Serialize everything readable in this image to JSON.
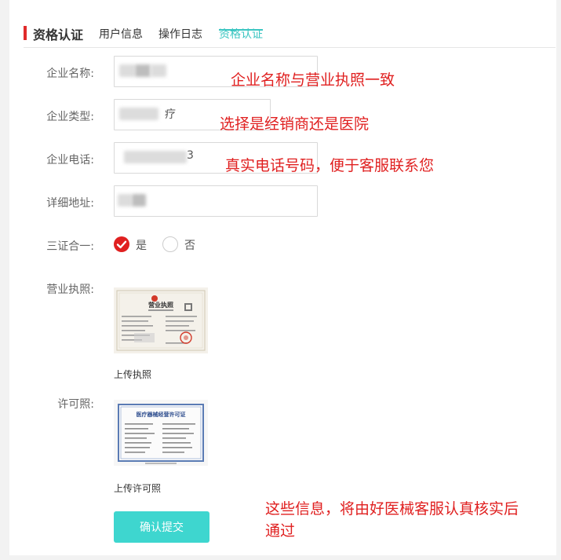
{
  "header": {
    "title": "资格认证",
    "tabs": [
      {
        "label": "用户信息"
      },
      {
        "label": "操作日志"
      },
      {
        "label": "资格认证",
        "active": true
      }
    ]
  },
  "form": {
    "company_name_label": "企业名称:",
    "company_type_label": "企业类型:",
    "company_type_tail": "疗",
    "company_phone_label": "企业电话:",
    "company_phone_tail": "3",
    "address_label": "详细地址:",
    "three_in_one_label": "三证合一:",
    "three_in_one_options": [
      "是",
      "否"
    ],
    "three_in_one_selected": "是",
    "business_license_label": "营业执照:",
    "business_license_doc_title": "营业执照",
    "upload_license_label": "上传执照",
    "permit_label": "许可照:",
    "permit_doc_title": "医疗器械经营许可证",
    "upload_permit_label": "上传许可照",
    "submit_label": "确认提交"
  },
  "annotations": {
    "name_note": "企业名称与营业执照一致",
    "type_note": "选择是经销商还是医院",
    "phone_note": "真实电话号码，便于客服联系您",
    "review_note_line1": "这些信息，将由好医械客服认真核实后",
    "review_note_line2": "通过"
  },
  "colors": {
    "accent_red": "#e02b2b",
    "tab_active": "#3cc6c2",
    "submit_bg": "#3ed6cf",
    "annotation": "#e02020"
  }
}
